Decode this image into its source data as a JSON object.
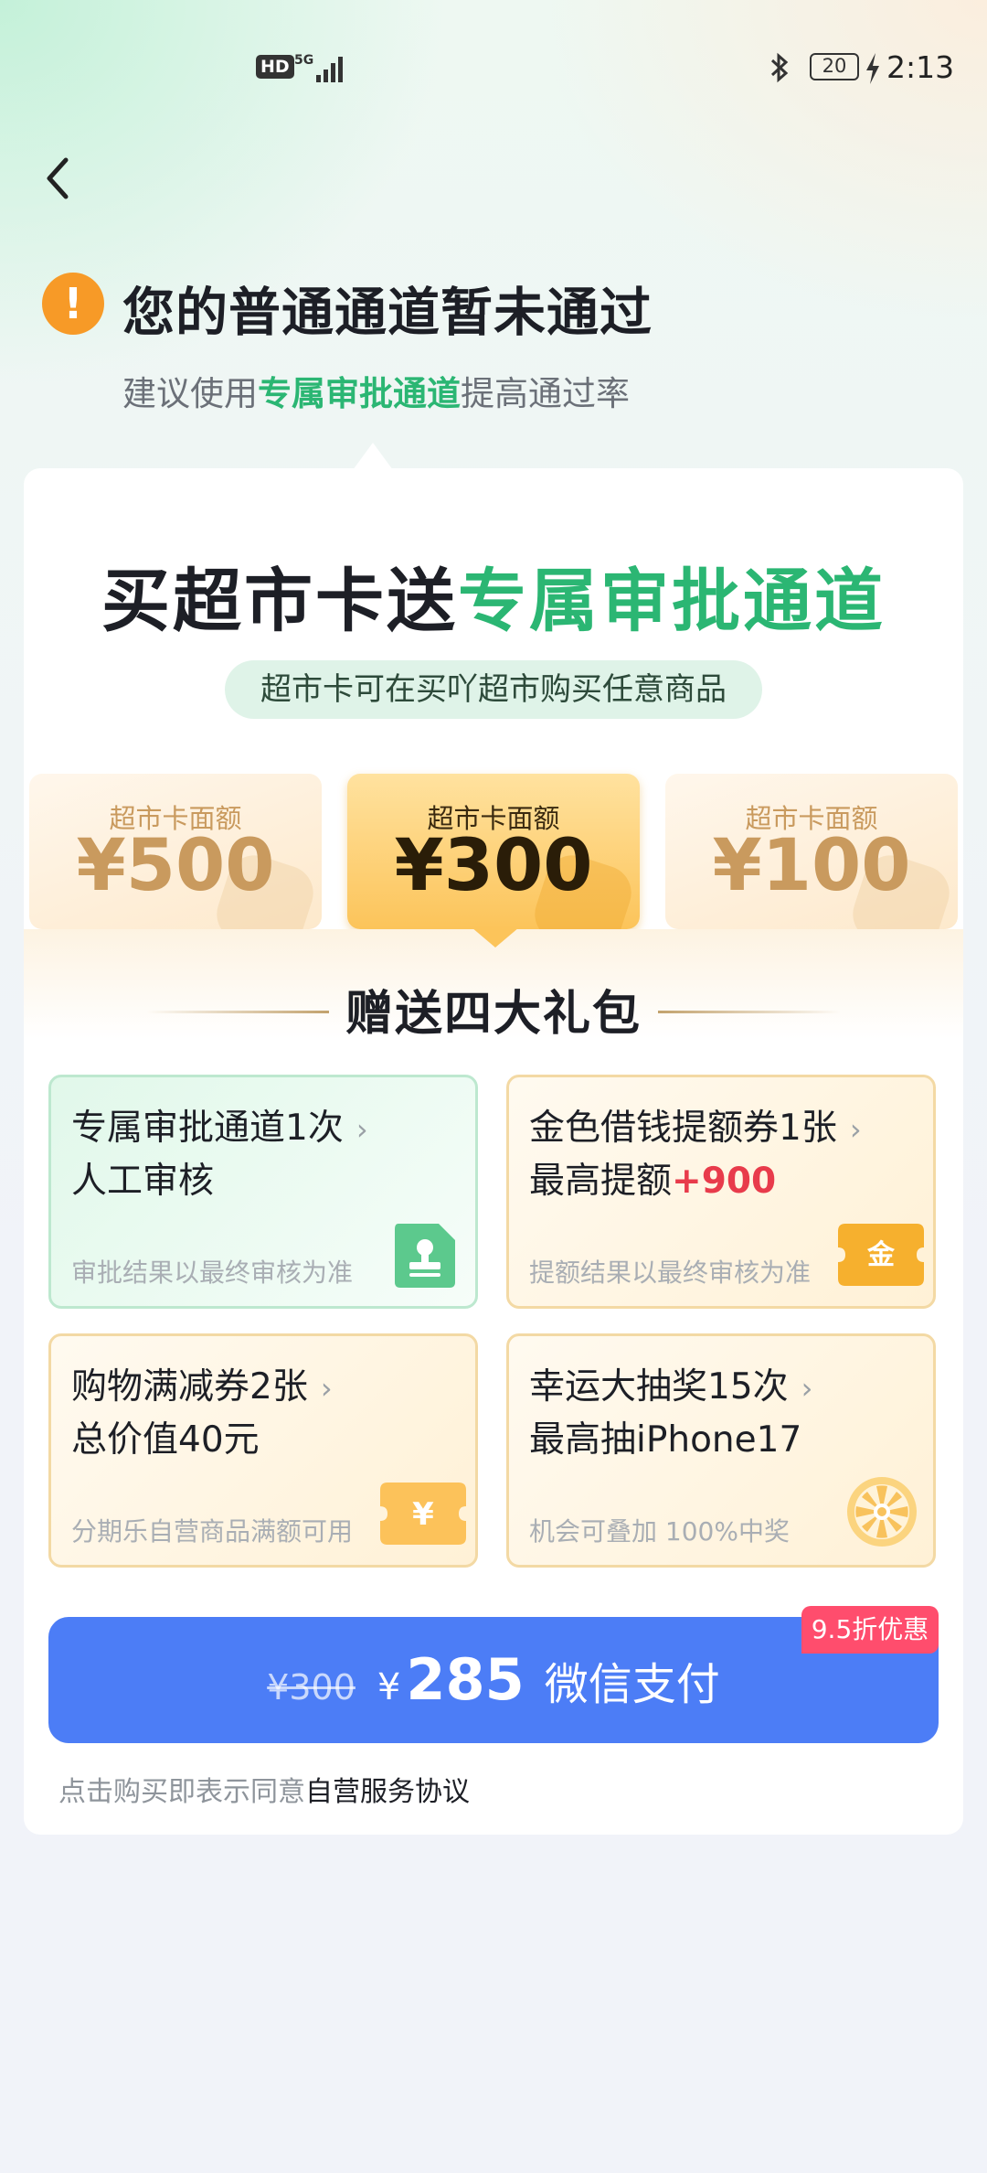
{
  "status_bar": {
    "hd": "HD",
    "network": "5G",
    "battery": "20",
    "time": "2:13"
  },
  "header": {
    "title": "您的普通通道暂未通过",
    "subtitle_pre": "建议使用",
    "subtitle_highlight": "专属审批通道",
    "subtitle_post": "提高通过率"
  },
  "card": {
    "title_pre": "买超市卡送",
    "title_highlight": "专属审批通道",
    "pill": "超市卡可在买吖超市购买任意商品",
    "denominations": [
      {
        "label": "超市卡面额",
        "amount": "¥500",
        "selected": false
      },
      {
        "label": "超市卡面额",
        "amount": "¥300",
        "selected": true
      },
      {
        "label": "超市卡面额",
        "amount": "¥100",
        "selected": false
      }
    ],
    "gift_title": "赠送四大礼包",
    "benefits": [
      {
        "line1": "专属审批通道1次",
        "line2": "人工审核",
        "line2_highlight": "",
        "note": "审批结果以最终审核为准",
        "icon": "stamp-icon"
      },
      {
        "line1": "金色借钱提额券1张",
        "line2": "最高提额",
        "line2_highlight": "+900",
        "note": "提额结果以最终审核为准",
        "icon": "gold-coupon-icon",
        "icon_text": "金"
      },
      {
        "line1": "购物满减券2张",
        "line2": "总价值40元",
        "line2_highlight": "",
        "note": "分期乐自营商品满额可用",
        "icon": "yen-coupon-icon",
        "icon_text": "¥"
      },
      {
        "line1": "幸运大抽奖15次",
        "line2": "最高抽iPhone17",
        "line2_highlight": "",
        "note": "机会可叠加 100%中奖",
        "icon": "lottery-wheel-icon"
      }
    ],
    "pay": {
      "old_price": "¥300",
      "currency": "¥",
      "price": "285",
      "label": "微信支付",
      "discount_badge": "9.5折优惠"
    },
    "agreement_pre": "点击购买即表示同意",
    "agreement_link": "自营服务协议"
  },
  "colors": {
    "accent_green": "#2bb673",
    "pay_blue": "#4c7df6",
    "warning_orange": "#f79a27",
    "badge_red": "#ff4d6d",
    "gold": "#fcc45a"
  }
}
